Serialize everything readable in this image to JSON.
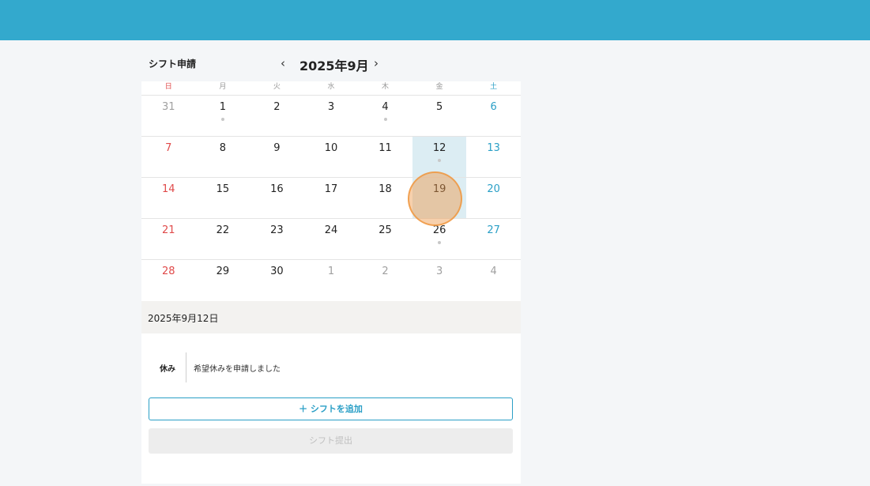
{
  "colors": {
    "topbar": "#33a9cd",
    "accent": "#2a9fc6",
    "sunday": "#e04a4a",
    "saturday": "#2a9fc6",
    "selected_bg": "#dcedf3"
  },
  "header": {
    "title": "シフト申請",
    "prev": "‹",
    "month": "2025年9月",
    "next": "›"
  },
  "weekdays": [
    "日",
    "月",
    "火",
    "水",
    "木",
    "金",
    "土"
  ],
  "weeks": [
    [
      "31",
      "1",
      "2",
      "3",
      "4",
      "5",
      "6"
    ],
    [
      "7",
      "8",
      "9",
      "10",
      "11",
      "12",
      "13"
    ],
    [
      "14",
      "15",
      "16",
      "17",
      "18",
      "19",
      "20"
    ],
    [
      "21",
      "22",
      "23",
      "24",
      "25",
      "26",
      "27"
    ],
    [
      "28",
      "29",
      "30",
      "1",
      "2",
      "3",
      "4"
    ]
  ],
  "selected_day": "12",
  "selected_date_label": "2025年9月12日",
  "request": {
    "type": "休み",
    "message": "希望休みを申請しました"
  },
  "add_button": "＋ シフトを追加",
  "submit_button": "シフト提出"
}
